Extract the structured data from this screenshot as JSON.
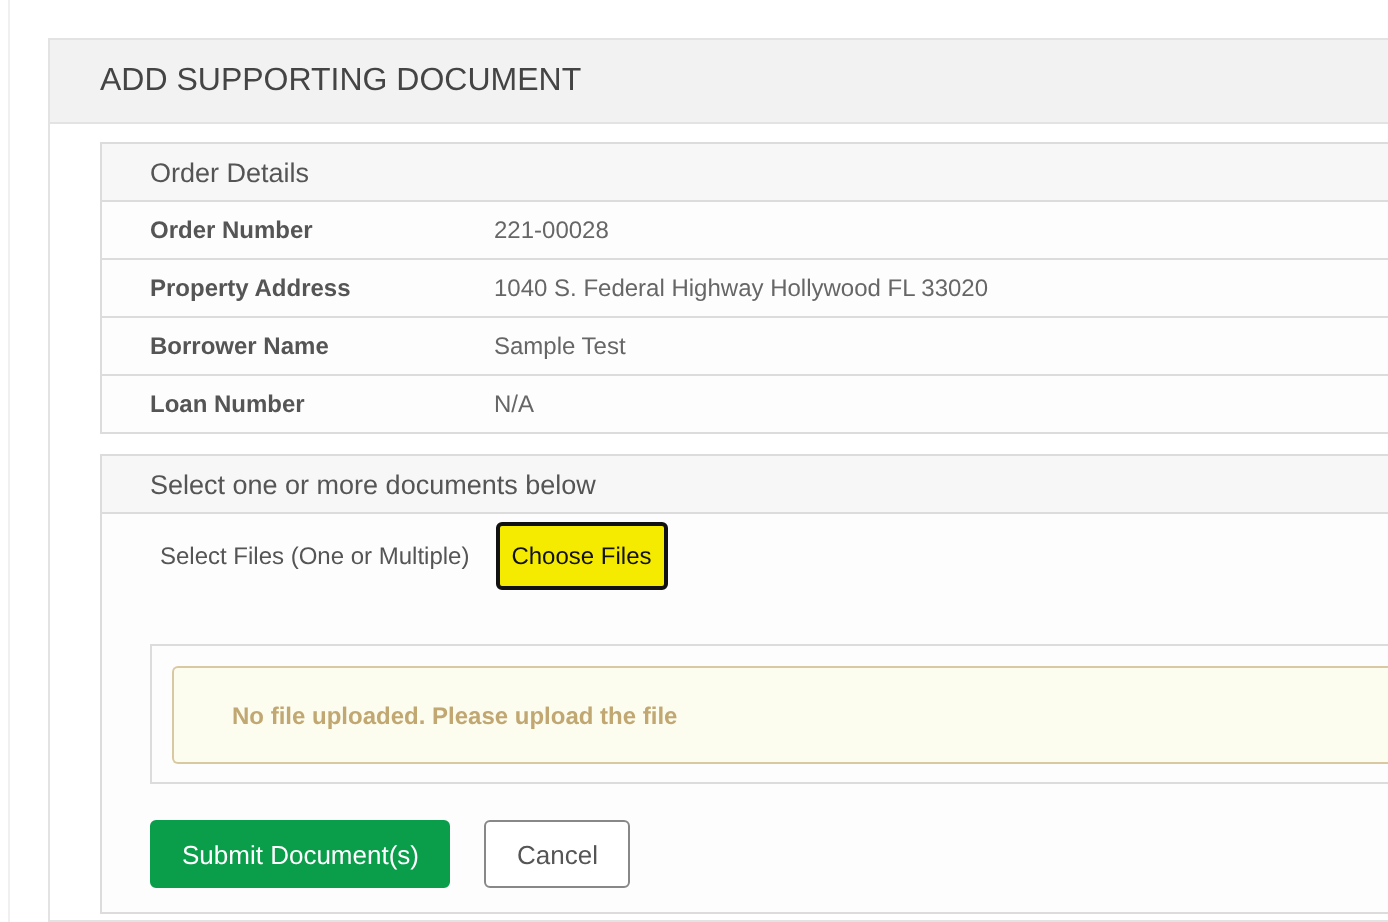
{
  "page": {
    "title": "ADD SUPPORTING DOCUMENT"
  },
  "order_details": {
    "title": "Order Details",
    "rows": [
      {
        "label": "Order Number",
        "value": "221-00028"
      },
      {
        "label": "Property Address",
        "value": "1040 S. Federal Highway Hollywood FL 33020"
      },
      {
        "label": "Borrower Name",
        "value": "Sample Test"
      },
      {
        "label": "Loan Number",
        "value": "N/A"
      }
    ]
  },
  "documents": {
    "title": "Select one or more documents below",
    "file_label": "Select Files (One or Multiple)",
    "choose_button": "Choose Files",
    "alert": "No file uploaded. Please upload the file"
  },
  "buttons": [
    {
      "label": "Submit Document(s)",
      "kind": "primary"
    },
    {
      "label": "Cancel",
      "kind": "secondary"
    }
  ]
}
